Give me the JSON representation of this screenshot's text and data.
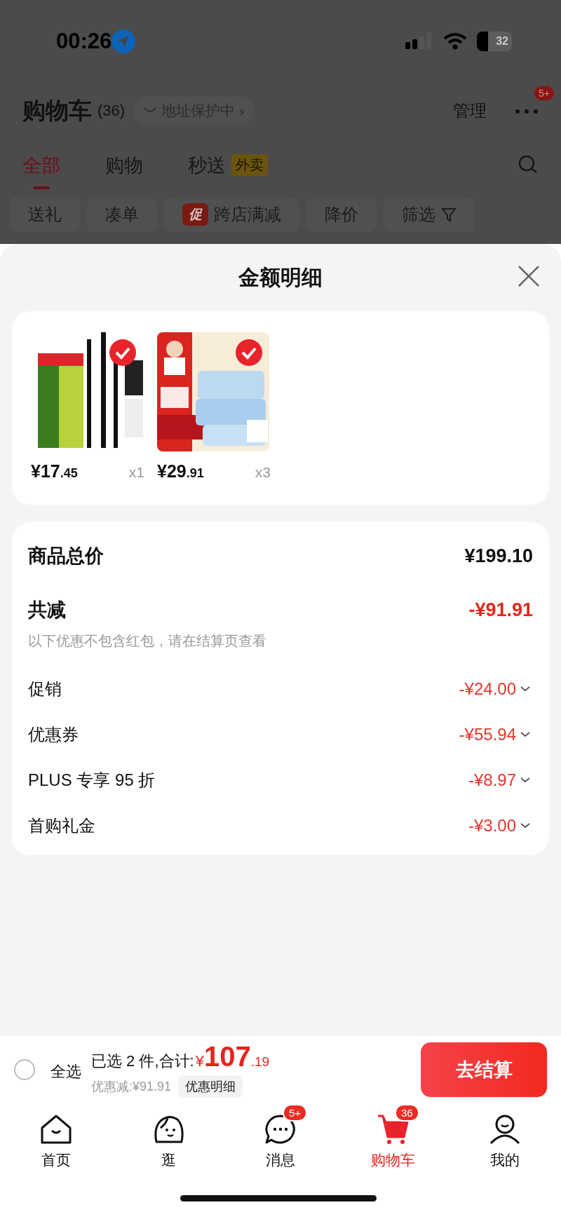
{
  "status_bar": {
    "time": "00:26",
    "battery": "32"
  },
  "header": {
    "title": "购物车",
    "count": "(36)",
    "address": "地址保护中",
    "address_arrow": "›",
    "manage": "管理",
    "more_badge": "5+"
  },
  "tabs": [
    {
      "label": "全部",
      "selected": true
    },
    {
      "label": "购物",
      "selected": false
    },
    {
      "label": "秒送",
      "tag": "外卖",
      "selected": false
    }
  ],
  "chips": [
    {
      "kind": "plain",
      "label": "送礼"
    },
    {
      "kind": "plain",
      "label": "凑单"
    },
    {
      "kind": "promo",
      "tag": "促",
      "label": "跨店满减"
    },
    {
      "kind": "plain",
      "label": "降价"
    },
    {
      "kind": "filter",
      "label": "筛选"
    }
  ],
  "sheet": {
    "title": "金额明细"
  },
  "products": [
    {
      "kind": "pens",
      "price_int": "¥17",
      "price_dec": ".45",
      "qty": "x1",
      "selected": true
    },
    {
      "kind": "wipes",
      "price_int": "¥29",
      "price_dec": ".91",
      "qty": "x3",
      "selected": true
    }
  ],
  "summary": {
    "total_label": "商品总价",
    "total_value": "¥199.10",
    "discount_label": "共减",
    "discount_value": "-¥91.91",
    "note": "以下优惠不包含红包，请在结算页查看",
    "items": [
      {
        "label": "促销",
        "value": "-¥24.00"
      },
      {
        "label": "优惠券",
        "value": "-¥55.94"
      },
      {
        "label": "PLUS 专享 95 折",
        "value": "-¥8.97"
      },
      {
        "label": "首购礼金",
        "value": "-¥3.00"
      }
    ]
  },
  "checkout": {
    "select_all": {
      "label": "全选",
      "checked": false
    },
    "selected_text": "已选 2 件,合计:",
    "currency": "¥",
    "total_int": "107",
    "total_dec": ".19",
    "saving": "优惠减:¥91.91",
    "detail_button": "优惠明细",
    "button": "去结算"
  },
  "nav": [
    {
      "kind": "home",
      "label": "首页",
      "selected": false
    },
    {
      "kind": "explore",
      "label": "逛",
      "selected": false
    },
    {
      "kind": "message",
      "label": "消息",
      "badge": "5+",
      "selected": false
    },
    {
      "kind": "cart",
      "label": "购物车",
      "badge": "36",
      "selected": true
    },
    {
      "kind": "me",
      "label": "我的",
      "selected": false
    }
  ]
}
